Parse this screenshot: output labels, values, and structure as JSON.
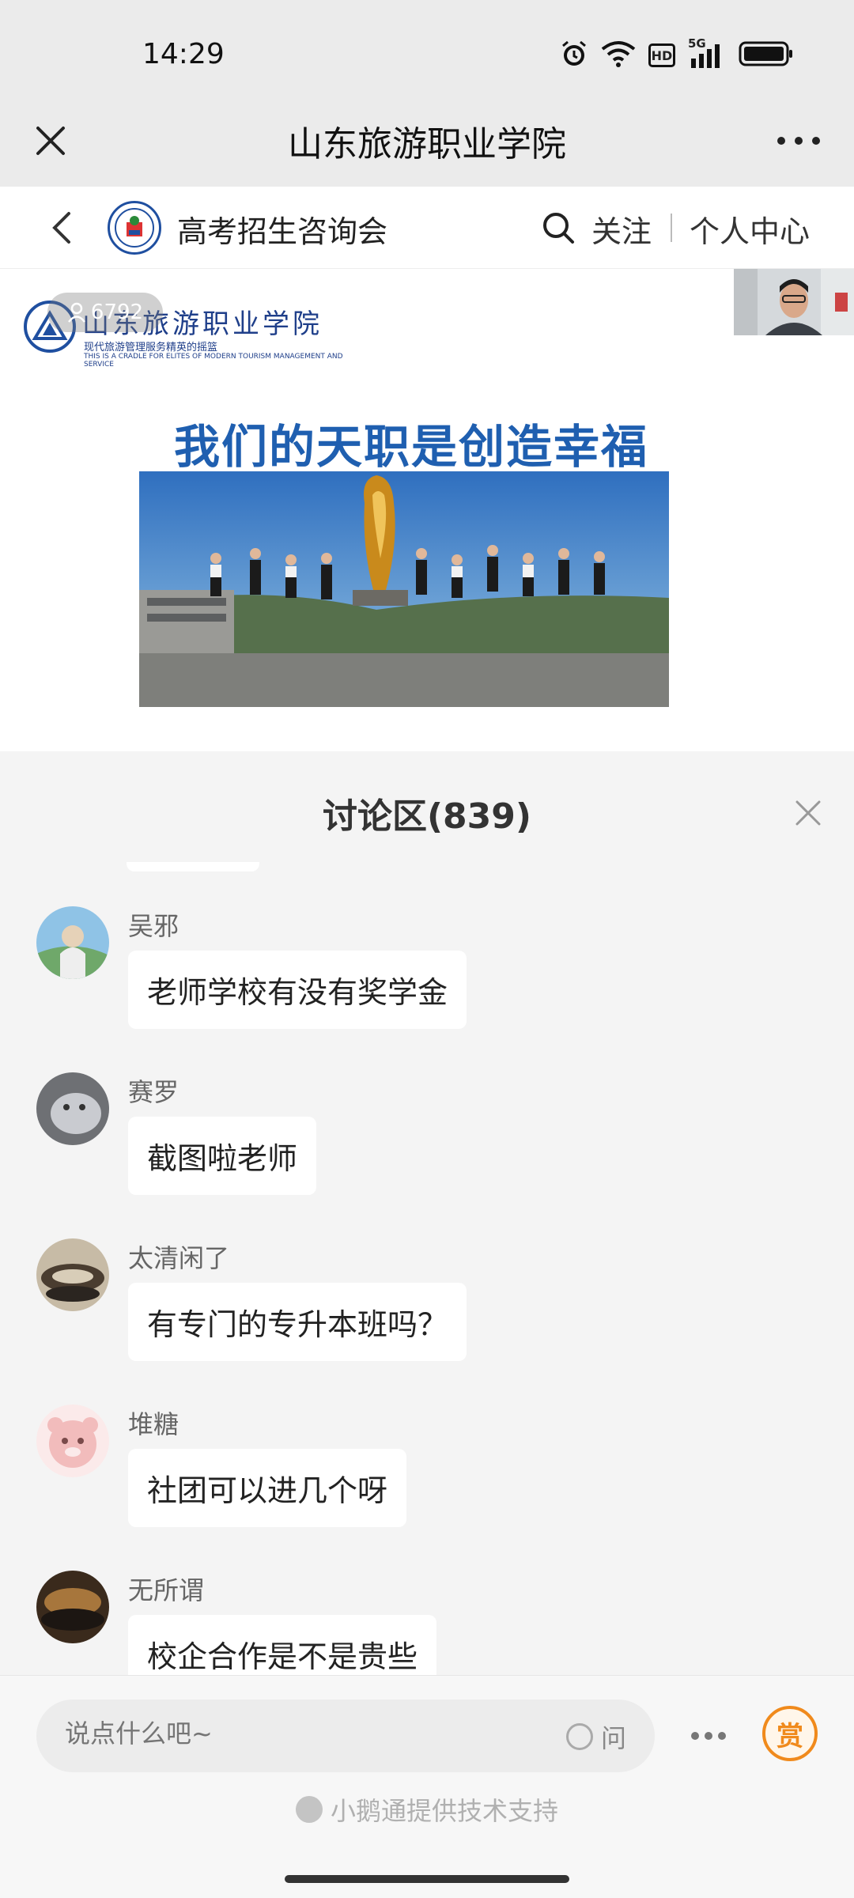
{
  "status_bar": {
    "time": "14:29",
    "network": "5G",
    "hd": "HD"
  },
  "title_bar": {
    "title": "山东旅游职业学院",
    "close_icon": "close-icon",
    "more_icon": "more-icon"
  },
  "channel": {
    "name": "高考招生咨询会",
    "follow_label": "关注",
    "center_label": "个人中心",
    "back_icon": "chevron-left-icon",
    "search_icon": "search-icon"
  },
  "video": {
    "viewer_count": "6792",
    "school_name_art": "山东旅游职业学院",
    "school_sub_cn": "现代旅游管理服务精英的摇篮",
    "school_sub_en": "THIS IS A CRADLE FOR ELITES OF MODERN TOURISM MANAGEMENT AND SERVICE",
    "slogan": "我们的天职是创造幸福"
  },
  "discussion": {
    "title": "讨论区(839)",
    "messages": [
      {
        "name": "吴邪",
        "text": "老师学校有没有奖学金",
        "avatar_color": "#6fa86a"
      },
      {
        "name": "赛罗",
        "text": "截图啦老师",
        "avatar_color": "#8d8f95"
      },
      {
        "name": "太清闲了",
        "text": "有专门的专升本班吗？",
        "avatar_color": "#5a4d40"
      },
      {
        "name": "堆糖",
        "text": "社团可以进几个呀",
        "avatar_color": "#f3c9c9"
      },
      {
        "name": "无所谓",
        "text": "校企合作是不是贵些",
        "avatar_color": "#6b4a2a"
      }
    ]
  },
  "input_bar": {
    "placeholder": "说点什么吧~",
    "ask_label": "问",
    "reward_label": "赏",
    "powered_by": "小鹅通提供技术支持"
  },
  "colors": {
    "accent_blue": "#1f5fb0",
    "reward_orange": "#f08a1c"
  }
}
